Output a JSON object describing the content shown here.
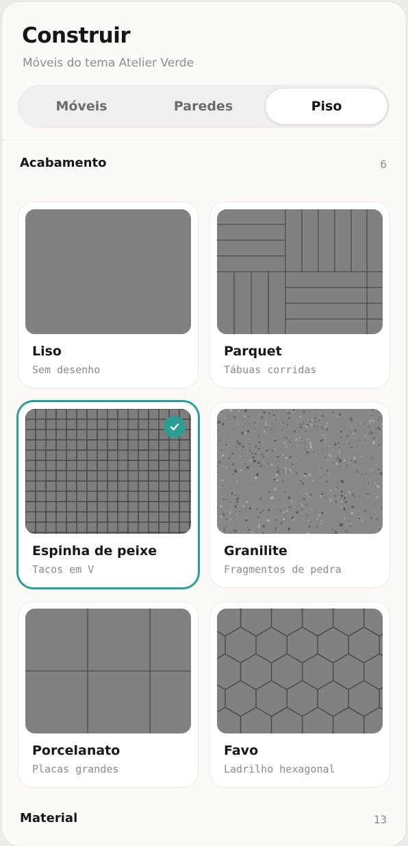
{
  "header": {
    "title": "Construir",
    "subtitle": "Móveis do tema Atelier Verde"
  },
  "tabs": [
    {
      "label": "Móveis",
      "active": false
    },
    {
      "label": "Paredes",
      "active": false
    },
    {
      "label": "Piso",
      "active": true
    }
  ],
  "sections": {
    "finish": {
      "title": "Acabamento",
      "count": "6"
    },
    "material": {
      "title": "Material",
      "count": "13"
    }
  },
  "finishes": [
    {
      "name": "Liso",
      "description": "Sem desenho",
      "pattern": "plain",
      "selected": false
    },
    {
      "name": "Parquet",
      "description": "Tábuas corridas",
      "pattern": "parquet",
      "selected": false
    },
    {
      "name": "Espinha de peixe",
      "description": "Tacos em V",
      "pattern": "herringbone",
      "selected": true
    },
    {
      "name": "Granilite",
      "description": "Fragmentos de pedra",
      "pattern": "terrazzo",
      "selected": false
    },
    {
      "name": "Porcelanato",
      "description": "Placas grandes",
      "pattern": "large-tiles",
      "selected": false
    },
    {
      "name": "Favo",
      "description": "Ladrilho hexagonal",
      "pattern": "hexagon",
      "selected": false
    }
  ],
  "colors": {
    "accent": "#2b9d94",
    "swatch_base": "#818181",
    "swatch_line": "#4a4a4a"
  },
  "icons": {
    "selected_check": "check-icon"
  }
}
